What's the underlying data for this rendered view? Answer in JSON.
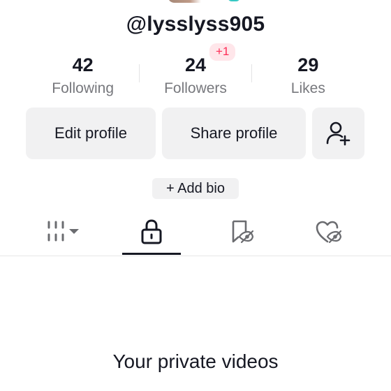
{
  "profile": {
    "username": "@lysslyss905"
  },
  "stats": [
    {
      "count": "42",
      "label": "Following"
    },
    {
      "count": "24",
      "label": "Followers",
      "badge": "+1"
    },
    {
      "count": "29",
      "label": "Likes"
    }
  ],
  "actions": {
    "edit_label": "Edit profile",
    "share_label": "Share profile",
    "add_friend_icon": "person-add-icon"
  },
  "bio": {
    "add_label": "+ Add bio"
  },
  "tabs": [
    {
      "icon": "grid-videos-icon",
      "active": false
    },
    {
      "icon": "lock-icon",
      "active": true
    },
    {
      "icon": "bookmark-icon",
      "active": false
    },
    {
      "icon": "heart-hidden-icon",
      "active": false
    }
  ],
  "content": {
    "title": "Your private videos"
  },
  "colors": {
    "text": "#161823",
    "secondary_text": "#77787d",
    "button_bg": "#f1f1f2",
    "badge_bg": "#ffe6ea",
    "badge_text": "#fe2c55"
  }
}
